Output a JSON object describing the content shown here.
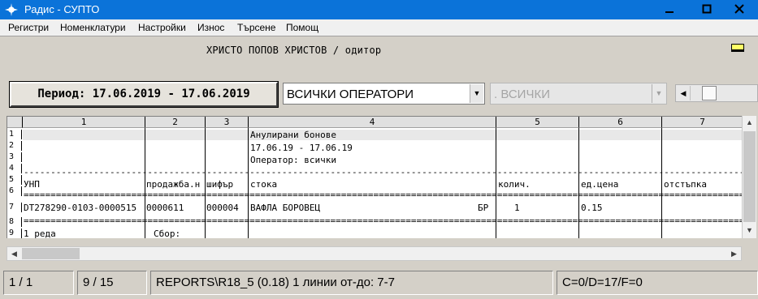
{
  "window": {
    "title": "Радис - СУПТО",
    "minimize": "—",
    "maximize": "▢",
    "close": "✕"
  },
  "menu": [
    "Регистри",
    "Номенклатури",
    "Настройки",
    "Износ",
    "Търсене",
    "Помощ"
  ],
  "header": {
    "company": "ХРИСТО ПОПОВ ХРИСТОВ / одитор"
  },
  "period_button": "Период: 17.06.2019 - 17.06.2019",
  "operators_combo": {
    "value": "ВСИЧКИ ОПЕРАТОРИ",
    "arrow": "▼"
  },
  "filter_combo": {
    "value": ". ВСИЧКИ",
    "arrow": "▼"
  },
  "top_scroll": {
    "left_arrow": "◀"
  },
  "grid": {
    "columns": [
      "1",
      "2",
      "3",
      "4",
      "5",
      "6",
      "7"
    ],
    "row_numbers": [
      "1",
      "2",
      "3",
      "4",
      "5",
      "6",
      "7",
      "8",
      "9"
    ],
    "rows": {
      "r1_c4": "Анулирани бонове",
      "r2_c4": "17.06.19 - 17.06.19",
      "r3_c4": "Оператор: всички",
      "dash_line": "------------------------------------------------------------------------------------------------------------------------------------------------------------------------",
      "eq_line": "========================================================================================================================================================================",
      "r5": [
        "УНП",
        "продажба.н",
        "шифър",
        "стока",
        "колич.",
        "ед.цена",
        "отстъпка"
      ],
      "r7": [
        "DT278290-0103-0000515",
        "0000611",
        "000004",
        "ВАФЛА БОРОВЕЦ",
        "БР",
        "1",
        "0.15"
      ],
      "r9_c1": "1 реда",
      "r9_c2": "Сбор:"
    }
  },
  "scrollbars": {
    "up": "▲",
    "down": "▼",
    "left": "◀",
    "right": "▶"
  },
  "status": {
    "position": "1 / 1",
    "rows": "9 / 15",
    "report": "REPORTS\\R18_5 (0.18) 1 линии от-до: 7-7",
    "flags": "C=0/D=17/F=0"
  },
  "colors": {
    "titlebar": "#0b73d9",
    "indicator": "#ffff66",
    "selected_row": "#e5ebf7"
  }
}
